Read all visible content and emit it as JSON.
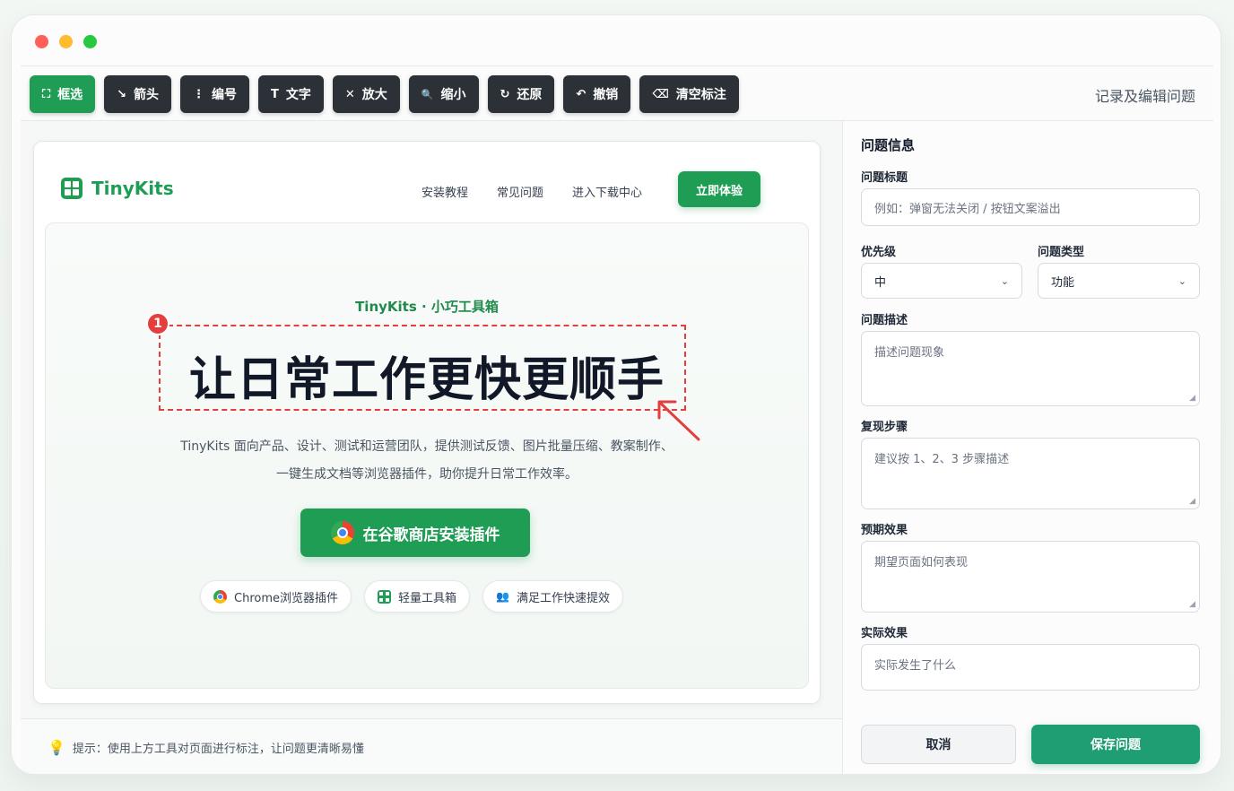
{
  "toolbar": {
    "title": "记录及编辑问题",
    "tools": [
      {
        "label": "框选",
        "icon": "select-box-icon",
        "glyph": "⛶"
      },
      {
        "label": "箭头",
        "icon": "arrow-icon",
        "glyph": "↘"
      },
      {
        "label": "编号",
        "icon": "number-icon",
        "glyph": "⋮"
      },
      {
        "label": "文字",
        "icon": "text-icon",
        "glyph": "T"
      },
      {
        "label": "放大",
        "icon": "zoom-in-icon",
        "glyph": "✕"
      },
      {
        "label": "缩小",
        "icon": "zoom-out-icon",
        "glyph": "🔍"
      },
      {
        "label": "还原",
        "icon": "reset-icon",
        "glyph": "↻"
      },
      {
        "label": "撤销",
        "icon": "undo-icon",
        "glyph": "↶"
      },
      {
        "label": "清空标注",
        "icon": "clear-icon",
        "glyph": "⌫"
      }
    ]
  },
  "site": {
    "logo": "TinyKits",
    "nav": [
      "安装教程",
      "常见问题",
      "进入下载中心"
    ],
    "try_button": "立即体验",
    "eyebrow": "TinyKits · 小巧工具箱",
    "headline": "让日常工作更快更顺手",
    "desc_line1": "TinyKits 面向产品、设计、测试和运营团队，提供测试反馈、图片批量压缩、教案制作、",
    "desc_line2": "一键生成文档等浏览器插件，助你提升日常工作效率。",
    "cta": "在谷歌商店安装插件",
    "pills": [
      "Chrome浏览器插件",
      "轻量工具箱",
      "满足工作快速提效"
    ],
    "annotation_number": "1"
  },
  "hint": "提示：使用上方工具对页面进行标注，让问题更清晰易懂",
  "panel": {
    "title": "问题信息",
    "issue_title_label": "问题标题",
    "issue_title_placeholder": "例如：弹窗无法关闭 / 按钮文案溢出",
    "priority_label": "优先级",
    "priority_value": "中",
    "type_label": "问题类型",
    "type_value": "功能",
    "desc_label": "问题描述",
    "desc_placeholder": "描述问题现象",
    "steps_label": "复现步骤",
    "steps_placeholder": "建议按 1、2、3 步骤描述",
    "expected_label": "预期效果",
    "expected_placeholder": "期望页面如何表现",
    "actual_label": "实际效果",
    "actual_placeholder": "实际发生了什么",
    "cancel": "取消",
    "save": "保存问题"
  },
  "colors": {
    "accent": "#1f9d55",
    "annotation": "#e53e3e",
    "save": "#1e9e72"
  }
}
